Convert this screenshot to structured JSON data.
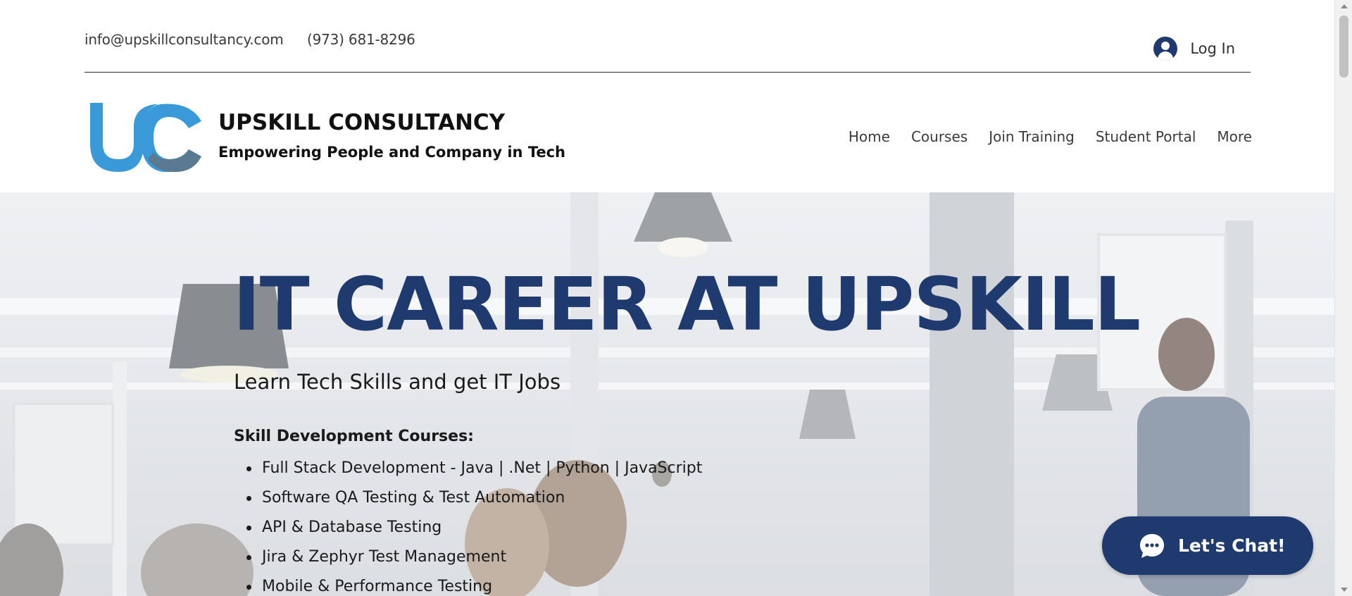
{
  "topbar": {
    "email": "info@upskillconsultancy.com",
    "phone": "(973) 681-8296",
    "login_label": "Log In"
  },
  "header": {
    "brand_title": "UPSKILL CONSULTANCY",
    "brand_tagline": "Empowering People and Company in Tech",
    "nav": [
      {
        "label": "Home"
      },
      {
        "label": "Courses"
      },
      {
        "label": "Join Training"
      },
      {
        "label": "Student Portal"
      },
      {
        "label": "More"
      }
    ]
  },
  "hero": {
    "title": "IT CAREER AT UPSKILL",
    "subtitle": "Learn Tech Skills and get IT Jobs",
    "courses_heading": "Skill Development Courses:",
    "courses": [
      "Full Stack Development - Java | .Net | Python | JavaScript",
      "Software QA Testing & Test Automation",
      "API & Database Testing",
      "Jira & Zephyr Test Management",
      "Mobile & Performance Testing"
    ]
  },
  "chat": {
    "label": "Let's Chat!"
  },
  "colors": {
    "brand_navy": "#1e3a6e",
    "logo_blue": "#3a9ad9",
    "logo_slate": "#5a7a91"
  },
  "icons": {
    "login": "user-avatar-icon",
    "chat": "chat-bubble-icon"
  }
}
